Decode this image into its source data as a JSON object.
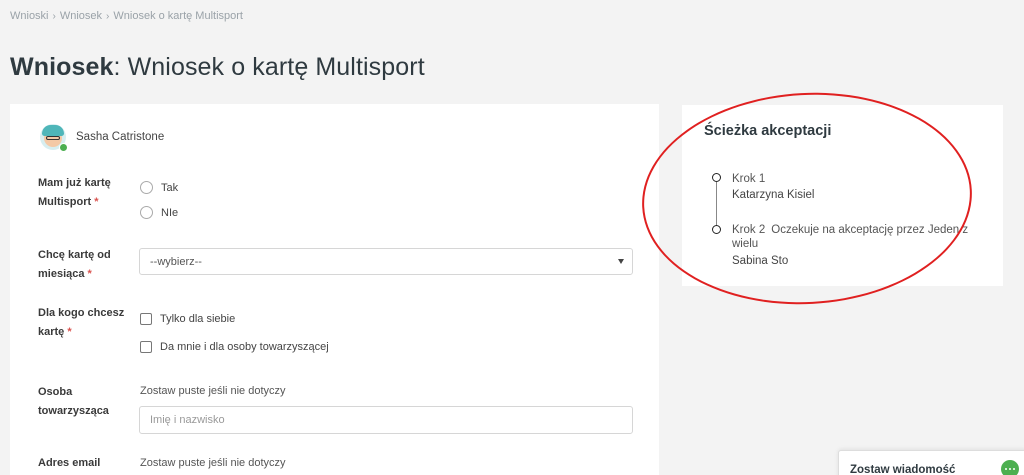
{
  "breadcrumb": [
    "Wnioski",
    "Wniosek",
    "Wniosek o kartę Multisport"
  ],
  "title": {
    "prefix": "Wniosek",
    "rest": ": Wniosek o kartę Multisport"
  },
  "user": {
    "name": "Sasha Catristone"
  },
  "form": {
    "has_card": {
      "label": "Mam już kartę Multisport",
      "options": [
        "Tak",
        "NIe"
      ]
    },
    "month": {
      "label": "Chcę kartę od miesiąca",
      "selected": "--wybierz--"
    },
    "for_whom": {
      "label": "Dla kogo chcesz kartę",
      "options": [
        "Tylko dla siebie",
        "Da mnie i dla osoby towarzyszącej"
      ]
    },
    "companion": {
      "label": "Osoba towarzysząca",
      "hint": "Zostaw puste jeśli nie dotyczy",
      "placeholder": "Imię i nazwisko"
    },
    "email": {
      "label": "Adres email",
      "hint": "Zostaw puste jeśli nie dotyczy"
    },
    "required_mark": "*"
  },
  "approval_path": {
    "title": "Ścieżka akceptacji",
    "steps": [
      {
        "label": "Krok 1",
        "status": "",
        "person": "Katarzyna Kisiel"
      },
      {
        "label": "Krok 2",
        "status": "Oczekuje na akceptację przez Jeden z wielu",
        "person": "Sabina Sto"
      }
    ]
  },
  "message": {
    "label": "Zostaw wiadomość"
  },
  "colors": {
    "accent_green": "#4caf50",
    "required_red": "#d9534f",
    "annotation_red": "#e02020"
  }
}
